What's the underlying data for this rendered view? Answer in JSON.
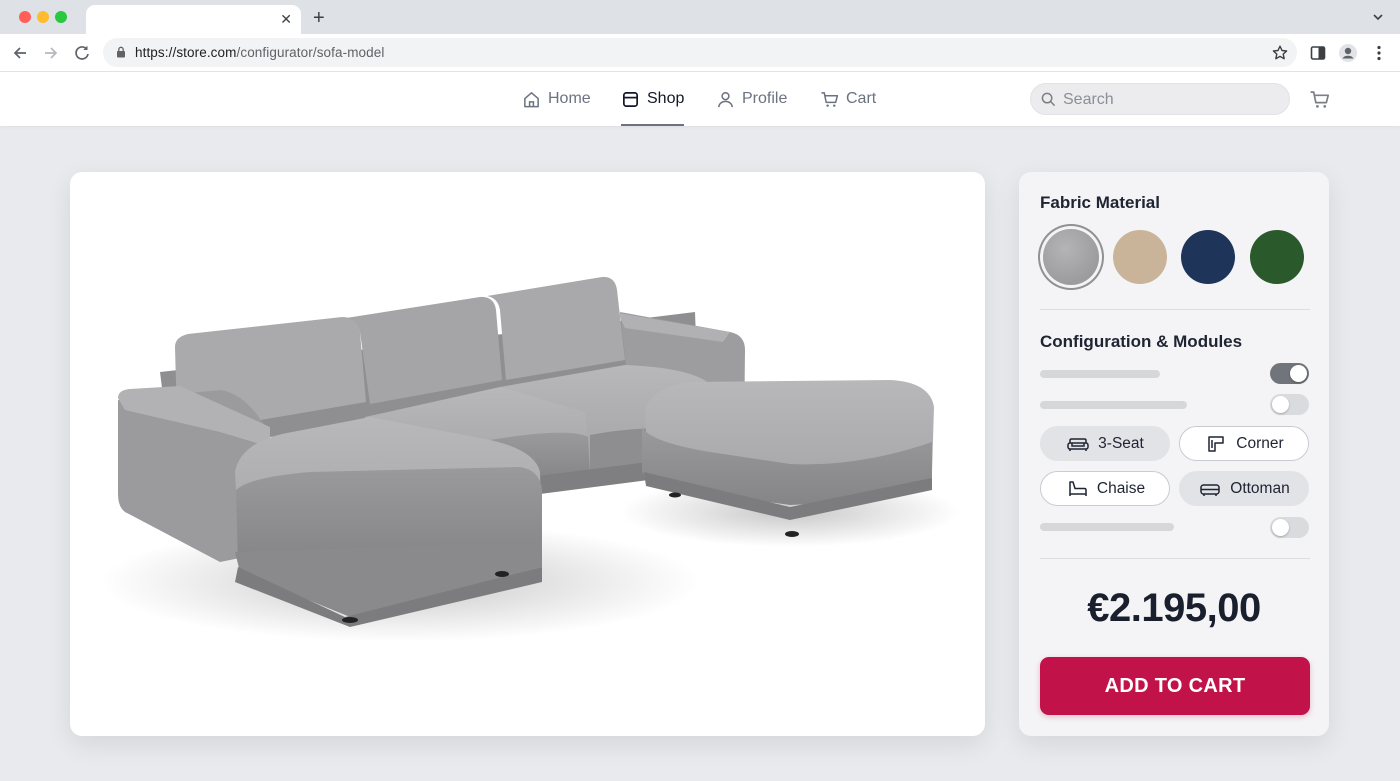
{
  "browser": {
    "url_host": "https://store.com",
    "url_path": "/configurator/sofa-model"
  },
  "nav": {
    "items": [
      {
        "label": "Home",
        "icon": "home-icon",
        "active": false
      },
      {
        "label": "Shop",
        "icon": "store-icon",
        "active": true
      },
      {
        "label": "Profile",
        "icon": "user-icon",
        "active": false
      },
      {
        "label": "Cart",
        "icon": "cart-icon",
        "active": false
      }
    ],
    "search_placeholder": "Search"
  },
  "configurator": {
    "fabric_title": "Fabric Material",
    "swatches": [
      {
        "color": "#9c9c9e",
        "selected": true
      },
      {
        "color": "#c9b49a",
        "selected": false
      },
      {
        "color": "#1f3459",
        "selected": false
      },
      {
        "color": "#2a5a2c",
        "selected": false
      }
    ],
    "modules_title": "Configuration & Modules",
    "toggles": [
      true,
      false,
      false
    ],
    "modules": [
      {
        "label": "3-Seat",
        "icon": "sofa-icon",
        "selected": true
      },
      {
        "label": "Corner",
        "icon": "corner-icon",
        "selected": false
      },
      {
        "label": "Chaise",
        "icon": "chaise-icon",
        "selected": false
      },
      {
        "label": "Ottoman",
        "icon": "ottoman-icon",
        "selected": true
      }
    ],
    "price": "€2.195,00",
    "cta_label": "ADD TO CART"
  },
  "colors": {
    "accent": "#c2124a",
    "fabric": "#9c9c9e"
  }
}
